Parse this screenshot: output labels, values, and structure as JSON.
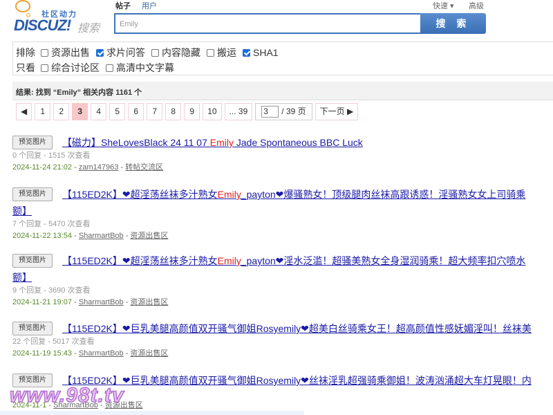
{
  "logo": {
    "sub": "社区动力",
    "main": "DISCUZ!",
    "search": "搜索"
  },
  "search": {
    "tabs": [
      "帖子",
      "用户"
    ],
    "value": "Emily",
    "button": "搜 索",
    "quick": "快速 ▾",
    "advanced": "高级"
  },
  "filters": {
    "exclude_label": "排除",
    "exclude": [
      {
        "label": "资源出售",
        "checked": false
      },
      {
        "label": "求片问答",
        "checked": true
      },
      {
        "label": "内容隐藏",
        "checked": false
      },
      {
        "label": "搬运",
        "checked": false
      },
      {
        "label": "SHA1",
        "checked": true
      }
    ],
    "only_label": "只看",
    "only": [
      {
        "label": "综合讨论区",
        "checked": false
      },
      {
        "label": "高清中文字幕",
        "checked": false
      }
    ]
  },
  "result_summary": "结果: 找到 “Emily” 相关内容 1161 个",
  "pagination": {
    "prev": "◀",
    "pages": [
      "1",
      "2",
      "3",
      "4",
      "5",
      "6",
      "7",
      "8",
      "9",
      "10",
      "... 39"
    ],
    "current": "3",
    "input": "3",
    "total": "/ 39 页",
    "next": "下一页 ▶"
  },
  "preview_label": "预览图片",
  "results": [
    {
      "pre": "【磁力】SheLovesBlack 24 11 07 ",
      "hl": "Emily",
      "post": " Jade Spontaneous BBC Luck",
      "cont": "",
      "stats": "0 个回复 - 1515 次查看",
      "date": "2024-11-24 21:02",
      "author": "zam147963",
      "forum": "转帖交流区"
    },
    {
      "pre": "【115ED2K】❤超淫荡丝袜多汁熟女",
      "hl": "Emily",
      "post": "_payton❤爆骚熟女！顶级腿肉丝袜高跟诱惑！淫骚熟女女上司骑乘",
      "cont": "额】",
      "stats": "7 个回复 - 5470 次查看",
      "date": "2024-11-22 13:54",
      "author": "SharmartBob",
      "forum": "资源出售区"
    },
    {
      "pre": "【115ED2K】❤超淫荡丝袜多汁熟女",
      "hl": "Emily",
      "post": "_payton❤淫水泛滥！超骚美熟女全身湿润骑乘！超大频率扣穴喷水",
      "cont": "额】",
      "stats": "9 个回复 - 3690 次查看",
      "date": "2024-11-21 19:07",
      "author": "SharmartBob",
      "forum": "资源出售区"
    },
    {
      "pre": "【115ED2K】❤巨乳美腿高颜值双开骚气御姐Rosyemily❤超美白丝骑乘女王！超高颜值性感妩媚淫叫！丝袜美",
      "hl": "",
      "post": "",
      "cont": "",
      "stats": "22 个回复 - 5017 次查看",
      "date": "2024-11-19 15:43",
      "author": "SharmartBob",
      "forum": "资源出售区"
    },
    {
      "pre": "【115ED2K】❤巨乳美腿高颜值双开骚气御姐Rosyemily❤丝袜淫乳超强骑乘御姐！波涛汹涌超大车灯晃眼！内",
      "hl": "",
      "post": "",
      "cont": "",
      "stats": "",
      "date": "2024-11-1",
      "author": "SharmartBob",
      "forum": "资源出售区"
    }
  ],
  "watermark": "www.98t.tv"
}
